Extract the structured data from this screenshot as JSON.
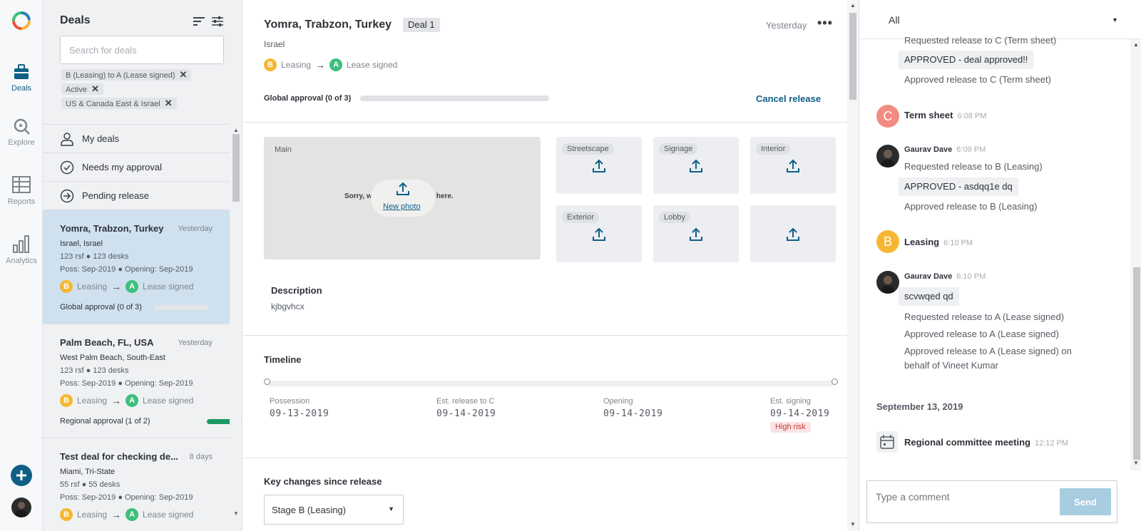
{
  "nav": {
    "items": [
      {
        "label": "Deals"
      },
      {
        "label": "Explore"
      },
      {
        "label": "Reports"
      },
      {
        "label": "Analytics"
      }
    ]
  },
  "deals": {
    "title": "Deals",
    "search_placeholder": "Search for deals",
    "chips": [
      {
        "label": "B (Leasing) to A (Lease signed)"
      },
      {
        "label": "Active"
      },
      {
        "label": "US & Canada East & Israel"
      }
    ],
    "quick": [
      {
        "label": "My deals"
      },
      {
        "label": "Needs my approval"
      },
      {
        "label": "Pending release"
      }
    ],
    "cards": [
      {
        "title": "Yomra, Trabzon, Turkey",
        "when": "Yesterday",
        "loc": "Israel, Israel",
        "size": "123 rsf ● 123 desks",
        "dates": "Poss: Sep-2019 ● Opening: Sep-2019",
        "from_badge": "B",
        "from_label": "Leasing",
        "to_badge": "A",
        "to_label": "Lease signed",
        "approval": "Global approval (0 of 3)",
        "approval_fraction": 0.0
      },
      {
        "title": "Palm Beach, FL, USA",
        "when": "Yesterday",
        "loc": "West Palm Beach, South-East",
        "size": "123 rsf ● 123 desks",
        "dates": "Poss: Sep-2019 ● Opening: Sep-2019",
        "from_badge": "B",
        "from_label": "Leasing",
        "to_badge": "A",
        "to_label": "Lease signed",
        "approval": "Regional approval (1 of 2)",
        "approval_fraction": 0.5
      },
      {
        "title": "Test deal for checking de...",
        "when": "8 days",
        "loc": "Miami, Tri-State",
        "size": "55 rsf ● 55 desks",
        "dates": "Poss: Sep-2019 ● Opening: Sep-2019",
        "from_badge": "B",
        "from_label": "Leasing",
        "to_badge": "A",
        "to_label": "Lease signed"
      }
    ]
  },
  "detail": {
    "title": "Yomra, Trabzon, Turkey",
    "tag": "Deal 1",
    "when": "Yesterday",
    "more": "•••",
    "country": "Israel",
    "from_badge": "B",
    "from_label": "Leasing",
    "to_badge": "A",
    "to_label": "Lease signed",
    "global_approval": "Global approval (0 of 3)",
    "cancel_release": "Cancel release",
    "photos": {
      "main_label": "Main",
      "empty_text": "Sorry, we have no imagery here.",
      "new_photo": "New photo",
      "slots": [
        "Streetscape",
        "Signage",
        "Interior",
        "Exterior",
        "Lobby",
        ""
      ]
    },
    "description_heading": "Description",
    "description": "kjbgvhcx",
    "timeline_heading": "Timeline",
    "timeline": [
      {
        "label": "Possession",
        "date": "09-13-2019"
      },
      {
        "label": "Est. release to C",
        "date": "09-14-2019"
      },
      {
        "label": "Opening",
        "date": "09-14-2019"
      },
      {
        "label": "Est. signing",
        "date": "09-14-2019",
        "risk": "High risk"
      }
    ],
    "key_changes_heading": "Key changes since release",
    "stage_select": "Stage B (Leasing)"
  },
  "activity": {
    "filter": "All",
    "lines": {
      "req_c": "Requested release to C (Term sheet)",
      "bubble1": "APPROVED - deal approved!!",
      "appr_c": "Approved release to C (Term sheet)",
      "term_badge": "C",
      "term_name": "Term sheet",
      "term_time": "6:08 PM",
      "user1_name": "Gaurav Dave",
      "user1_time": "6:09 PM",
      "req_b": "Requested release to B (Leasing)",
      "bubble2": "APPROVED - asdqq1e dq",
      "appr_b": "Approved release to B (Leasing)",
      "leasing_badge": "B",
      "leasing_name": "Leasing",
      "leasing_time": "6:10 PM",
      "user2_name": "Gaurav Dave",
      "user2_time": "6:10 PM",
      "bubble3": "scvwqed qd",
      "req_a": "Requested release to A (Lease signed)",
      "appr_a": "Approved release to A (Lease signed)",
      "appr_a_behalf_1": "Approved release to A (Lease signed) on",
      "appr_a_behalf_2": "behalf of Vineet Kumar",
      "date_sep": "September 13, 2019",
      "meeting_name": "Regional committee meeting",
      "meeting_time": "12:12 PM"
    },
    "comment_placeholder": "Type a comment",
    "send_label": "Send"
  },
  "colors": {
    "accent": "#0f5f86",
    "badge_b": "#f5b731",
    "badge_a": "#3dbf7d",
    "badge_c": "#f28b82",
    "selected_card": "#cfe1ee",
    "approval_fill": "#1a9a63"
  }
}
